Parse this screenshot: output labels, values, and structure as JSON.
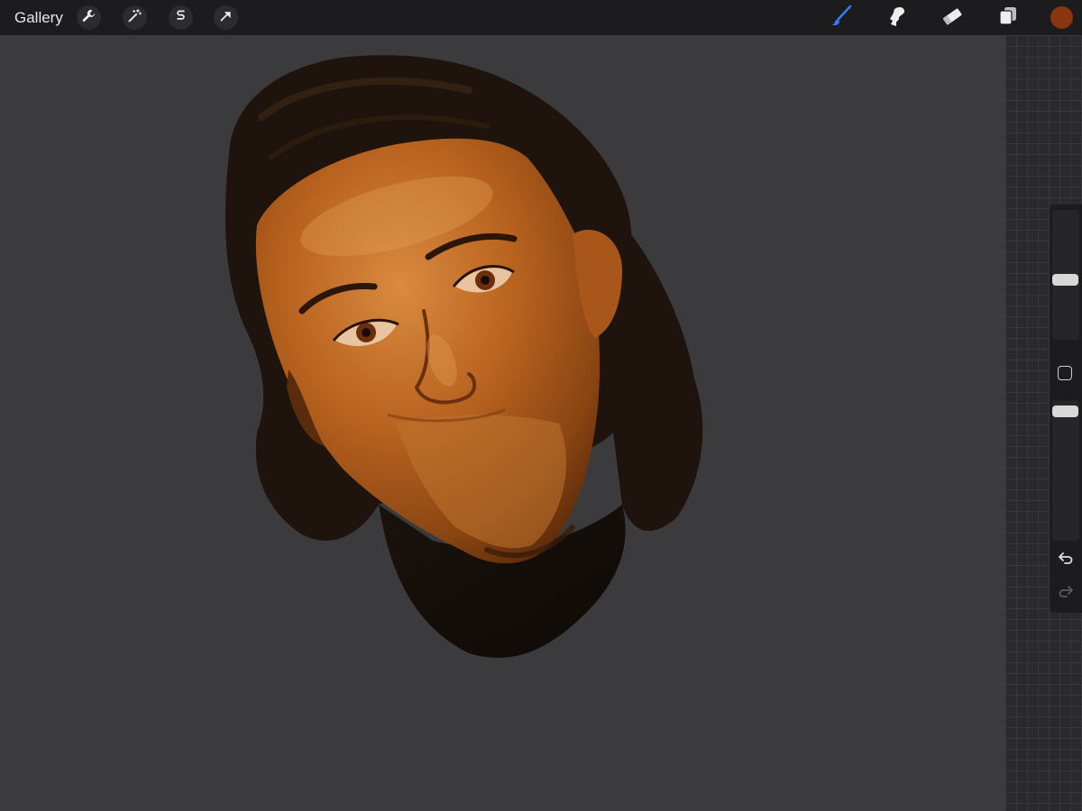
{
  "topbar": {
    "gallery_label": "Gallery",
    "left_tools": [
      {
        "name": "actions",
        "icon": "wrench-icon"
      },
      {
        "name": "adjustments",
        "icon": "magic-wand-icon"
      },
      {
        "name": "selection",
        "icon": "selection-s-icon"
      },
      {
        "name": "transform",
        "icon": "arrow-cursor-icon"
      }
    ],
    "right_tools": [
      {
        "name": "brush",
        "icon": "brush-icon",
        "active": true
      },
      {
        "name": "smudge",
        "icon": "smudge-icon"
      },
      {
        "name": "eraser",
        "icon": "eraser-icon"
      },
      {
        "name": "layers",
        "icon": "layers-icon"
      }
    ],
    "current_color": "#8a3410",
    "active_tool_color": "#2f7cf6"
  },
  "sidebar": {
    "brush_size_level": 0.6,
    "opacity_level": 1.0,
    "undo_icon": "undo-icon",
    "redo_icon": "redo-icon"
  },
  "canvas": {
    "background": "#3b3b3d",
    "artwork": "digital-portrait-painting"
  }
}
